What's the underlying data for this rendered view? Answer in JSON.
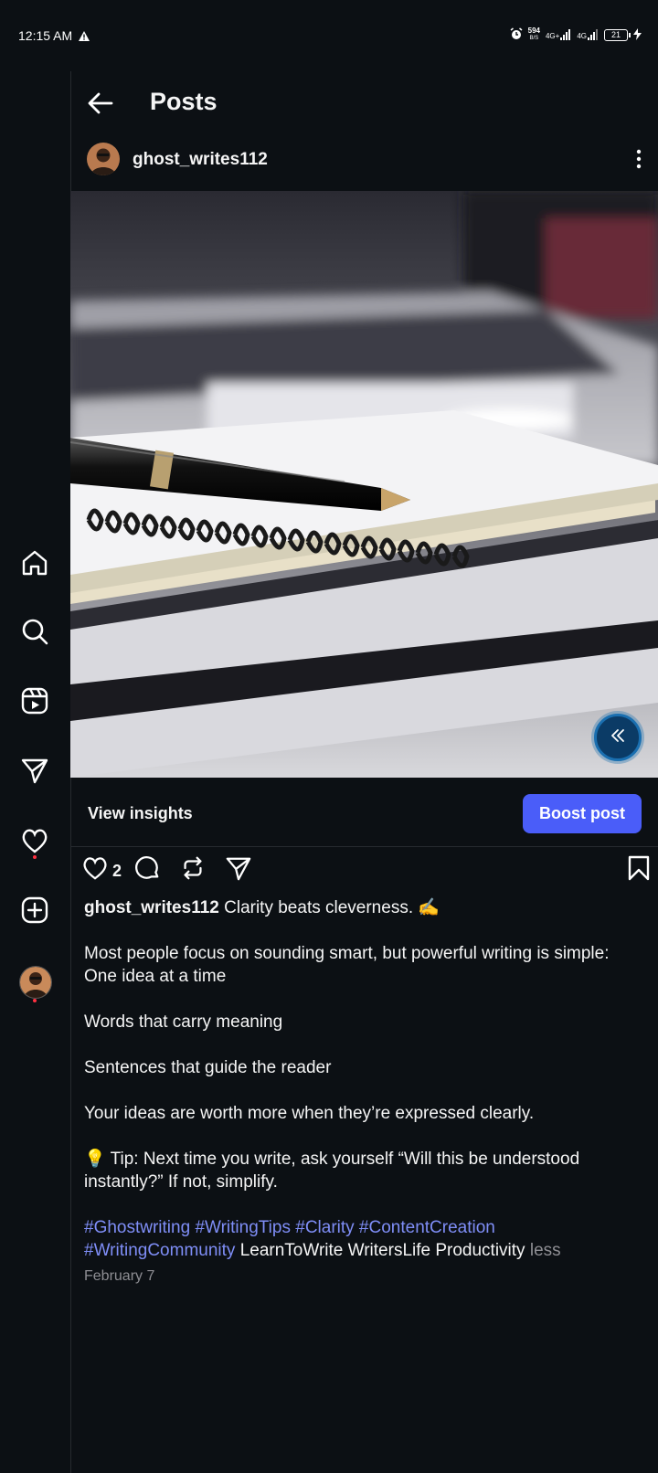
{
  "status_bar": {
    "time": "12:15 AM",
    "net_speed": "594",
    "net_unit": "B/S",
    "signal1": "4G+",
    "signal2": "4G",
    "battery": "21"
  },
  "header": {
    "title": "Posts"
  },
  "post": {
    "username": "ghost_writes112",
    "view_insights": "View insights",
    "boost_label": "Boost post",
    "like_count": "2",
    "caption": {
      "username": "ghost_writes112",
      "first_line": "Clarity beats cleverness. ✍️",
      "line2": "Most people focus on sounding smart, but powerful writing is simple:",
      "line3": "One idea at a time",
      "line4": "Words that carry meaning",
      "line5": "Sentences that guide the reader",
      "line6": "Your ideas are worth more when they’re expressed clearly.",
      "line7": "💡 Tip: Next time you write, ask yourself “Will this be understood instantly?” If not, simplify.",
      "hashtags_line1": "#Ghostwriting #WritingTips #Clarity #ContentCreation",
      "hashtags_line2": "#WritingCommunity",
      "plain_tags": "LearnToWrite WritersLife Productivity",
      "less": "less"
    },
    "date": "February 7"
  },
  "icons": {
    "rail": [
      "home-icon",
      "search-icon",
      "reels-icon",
      "direct-icon",
      "heart-icon",
      "create-icon",
      "profile-avatar"
    ],
    "actions": [
      "like-icon",
      "comment-icon",
      "repost-icon",
      "share-icon",
      "save-icon"
    ]
  },
  "colors": {
    "background": "#0c1014",
    "boost": "#4a5df9",
    "hashtag": "#7f8ef7",
    "notification_dot": "#ff3040"
  }
}
